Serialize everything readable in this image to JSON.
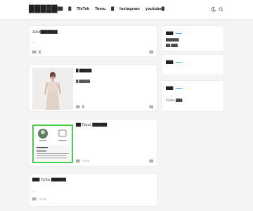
{
  "site": {
    "logo": "█████"
  },
  "nav": {
    "items": [
      "██",
      "██",
      "█",
      "TikTok",
      "Temu",
      "█",
      "Instagram",
      "youtube█"
    ]
  },
  "header": {
    "moon_icon": "moon-icon",
    "search_icon": "search-icon"
  },
  "posts": [
    {
      "title": "1000███████",
      "excerpt": "...",
      "meta_left": "██ · █",
      "meta_right": "██"
    },
    {
      "title": "█:█████",
      "excerpt": "█:█████ ...",
      "meta_left": "██ · █",
      "meta_right": "██"
    },
    {
      "title": "██ Tiktok ██████",
      "excerpt": "...",
      "meta_left": "██ · TikTok",
      "meta_right": "██"
    },
    {
      "title": "███ TikTok ██████",
      "excerpt": "...",
      "meta_left": "██ · TikTok",
      "meta_right": ""
    }
  ],
  "widgets": [
    {
      "title": "███",
      "lines": [
        "██████",
        "██ ███"
      ]
    },
    {
      "title": "███",
      "lines": []
    },
    {
      "title": "███",
      "lines": [
        "5Links ███"
      ]
    }
  ],
  "colors": {
    "accent": "#4aa0e0",
    "page_bg": "#f4f4f4",
    "card_bg": "#ffffff",
    "green_border": "#48d04b"
  }
}
